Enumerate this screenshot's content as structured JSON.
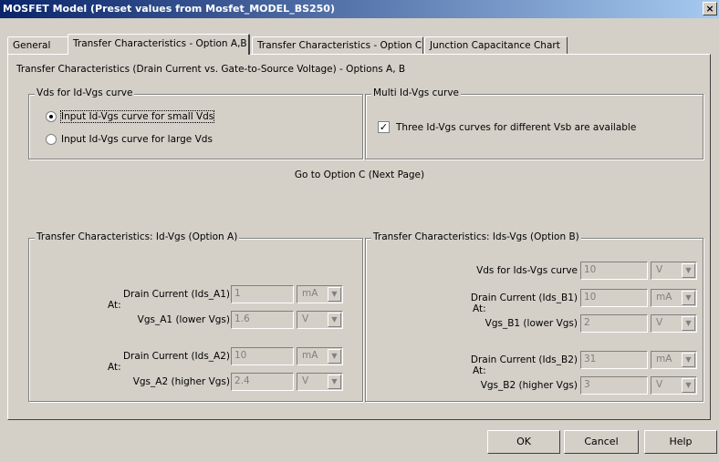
{
  "window": {
    "title": "MOSFET Model (Preset values from Mosfet_MODEL_BS250)",
    "close_glyph": "×"
  },
  "tabs": [
    {
      "label": "General"
    },
    {
      "label": "Transfer Characteristics - Option A,B"
    },
    {
      "label": "Transfer Characteristics - Option C"
    },
    {
      "label": "Junction Capacitance Chart"
    }
  ],
  "heading": "Transfer Characteristics (Drain Current vs. Gate-to-Source Voltage) - Options A, B",
  "vds_group": {
    "legend": "Vds for Id-Vgs curve",
    "options": [
      {
        "label": "Input Id-Vgs curve for small Vds",
        "checked": true
      },
      {
        "label": "Input Id-Vgs curve for large Vds",
        "checked": false
      }
    ]
  },
  "multi_group": {
    "legend": "Multi Id-Vgs curve",
    "checkbox_label": "Three Id-Vgs curves for different Vsb are available",
    "checked": true
  },
  "goto_label": "Go to Option C (Next Page)",
  "option_a": {
    "legend": "Transfer Characteristics: Id-Vgs (Option A)",
    "at_label": "At:",
    "drain1_label": "Drain Current (Ids_A1)",
    "drain1_value": "1",
    "drain1_unit": "mA",
    "vgs1_label": "Vgs_A1 (lower Vgs)",
    "vgs1_value": "1.6",
    "vgs1_unit": "V",
    "drain2_label": "Drain Current (Ids_A2)",
    "drain2_value": "10",
    "drain2_unit": "mA",
    "vgs2_label": "Vgs_A2 (higher Vgs)",
    "vgs2_value": "2.4",
    "vgs2_unit": "V"
  },
  "option_b": {
    "legend": "Transfer Characteristics: Ids-Vgs (Option B)",
    "at_label": "At:",
    "vds_label": "Vds for Ids-Vgs curve",
    "vds_value": "10",
    "vds_unit": "V",
    "drain1_label": "Drain Current (Ids_B1)",
    "drain1_value": "10",
    "drain1_unit": "mA",
    "vgs1_label": "Vgs_B1 (lower Vgs)",
    "vgs1_value": "2",
    "vgs1_unit": "V",
    "drain2_label": "Drain Current (Ids_B2)",
    "drain2_value": "31",
    "drain2_unit": "mA",
    "vgs2_label": "Vgs_B2 (higher Vgs)",
    "vgs2_value": "3",
    "vgs2_unit": "V"
  },
  "buttons": {
    "ok": "OK",
    "cancel": "Cancel",
    "help": "Help"
  },
  "dropdown_arrow": "▼",
  "colors": {
    "title_start": "#0a246a",
    "title_end": "#a6caf0",
    "face": "#d4d0c8"
  }
}
